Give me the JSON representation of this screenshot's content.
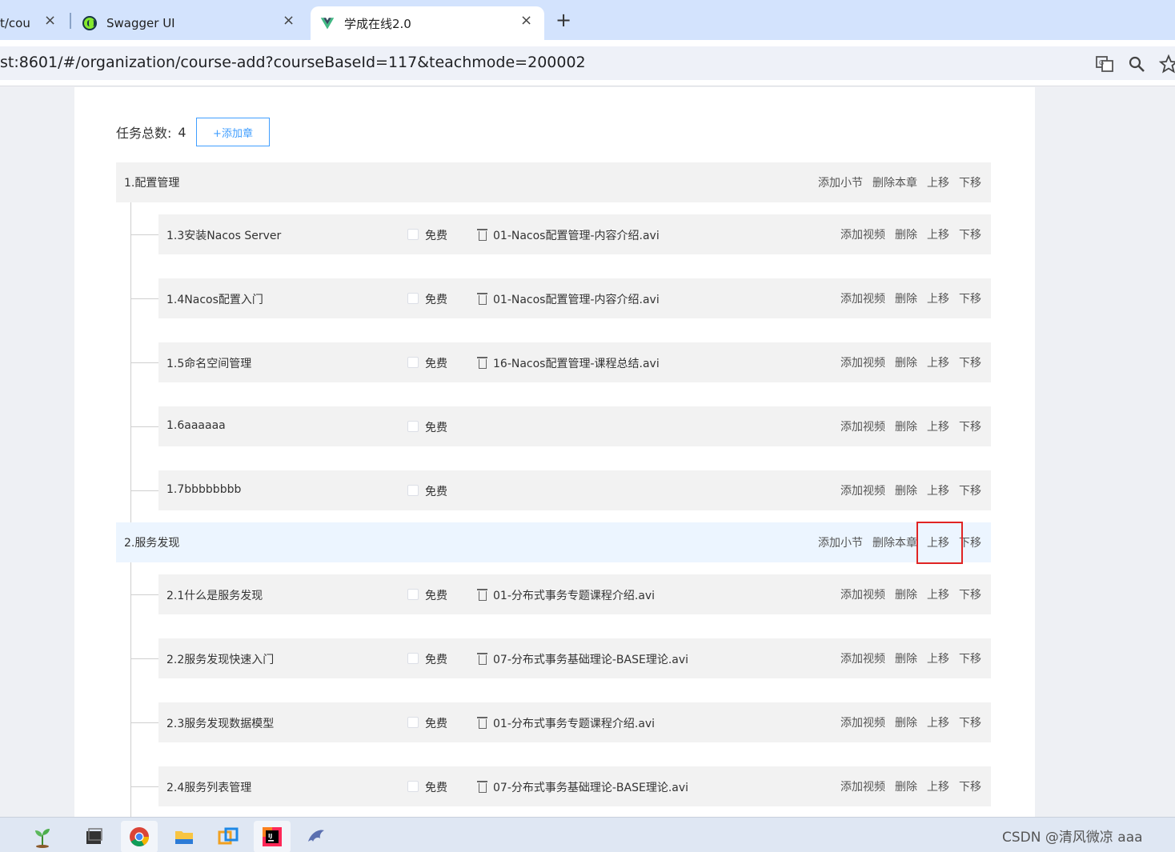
{
  "browser": {
    "tabs": [
      {
        "title": "t/cou",
        "close": "×"
      },
      {
        "title": "Swagger UI",
        "close": "×"
      },
      {
        "title": "学成在线2.0",
        "close": "×"
      }
    ],
    "new_tab": "+",
    "url": "st:8601/#/organization/course-add?courseBaseId=117&teachmode=200002"
  },
  "page": {
    "summary_label": "任务总数:",
    "summary_count": "4",
    "add_chapter": "+添加章",
    "chapter_actions": [
      "添加小节",
      "删除本章",
      "上移",
      "下移"
    ],
    "section_actions": [
      "添加视频",
      "删除",
      "上移",
      "下移"
    ],
    "free_label": "免费",
    "chapters": [
      {
        "title": "1.配置管理",
        "sections": [
          {
            "title": "1.3安装Nacos Server",
            "video": "01-Nacos配置管理-内容介绍.avi"
          },
          {
            "title": "1.4Nacos配置入门",
            "video": "01-Nacos配置管理-内容介绍.avi"
          },
          {
            "title": "1.5命名空间管理",
            "video": "16-Nacos配置管理-课程总结.avi"
          },
          {
            "title": "1.6aaaaaa",
            "video": ""
          },
          {
            "title": "1.7bbbbbbbb",
            "video": ""
          }
        ]
      },
      {
        "title": "2.服务发现",
        "sections": [
          {
            "title": "2.1什么是服务发现",
            "video": "01-分布式事务专题课程介绍.avi"
          },
          {
            "title": "2.2服务发现快速入门",
            "video": "07-分布式事务基础理论-BASE理论.avi"
          },
          {
            "title": "2.3服务发现数据模型",
            "video": "01-分布式事务专题课程介绍.avi"
          },
          {
            "title": "2.4服务列表管理",
            "video": "07-分布式事务基础理论-BASE理论.avi"
          }
        ]
      }
    ]
  },
  "taskbar": {
    "tray_text": "CSDN @清风微凉 aaa"
  },
  "colors": {
    "accent": "#409eff",
    "highlight_box": "#e02424",
    "active_chapter_bg": "#ecf5ff",
    "row_bg": "#f2f2f2"
  }
}
